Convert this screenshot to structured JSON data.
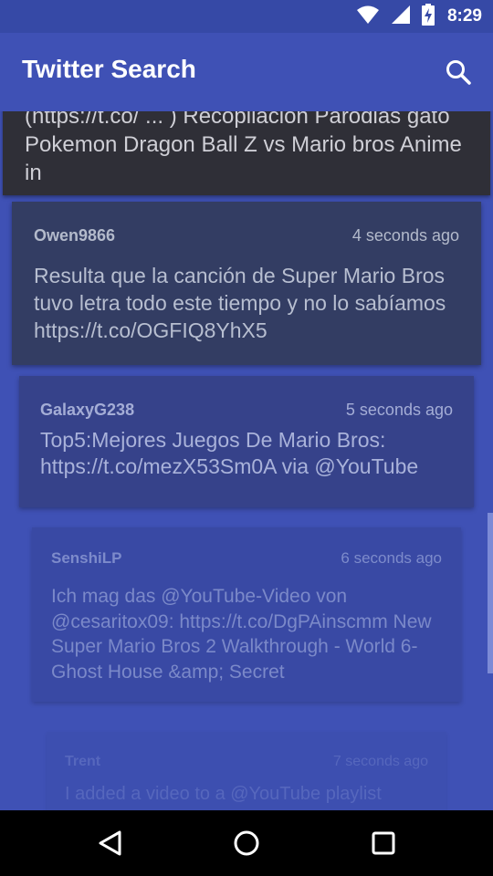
{
  "status_bar": {
    "time": "8:29",
    "icons": [
      "wifi-icon",
      "signal-icon",
      "battery-charging-icon"
    ]
  },
  "app_bar": {
    "title": "Twitter Search",
    "action_icon": "search-icon"
  },
  "tweets": [
    {
      "user": "",
      "time_ago": "",
      "text": "(https://t.co/ ... ) Recopilación Parodias gato Pokemon Dragon Ball Z vs Mario bros Anime in"
    },
    {
      "user": "Owen9866",
      "time_ago": "4 seconds ago",
      "text": "Resulta que la canción de Super Mario Bros tuvo letra todo este tiempo y no lo sabíamos https://t.co/OGFIQ8YhX5"
    },
    {
      "user": "GalaxyG238",
      "time_ago": "5 seconds ago",
      "text": "Top5:Mejores Juegos De Mario Bros: https://t.co/mezX53Sm0A via @YouTube"
    },
    {
      "user": "SenshiLP",
      "time_ago": "6 seconds ago",
      "text": "Ich mag das @YouTube-Video von @cesaritox09: https://t.co/DgPAinscmm New Super Mario Bros 2 Walkthrough - World 6-Ghost House &amp; Secret"
    },
    {
      "user": "Trent",
      "time_ago": "7 seconds ago",
      "text": "I added a video to a @YouTube playlist"
    }
  ],
  "nav_bar": {
    "icons": [
      "back-icon",
      "home-icon",
      "recents-icon"
    ]
  },
  "colors": {
    "primary": "#3F51B5",
    "status_bar": "#3649A6",
    "nav_bar": "#000000"
  }
}
